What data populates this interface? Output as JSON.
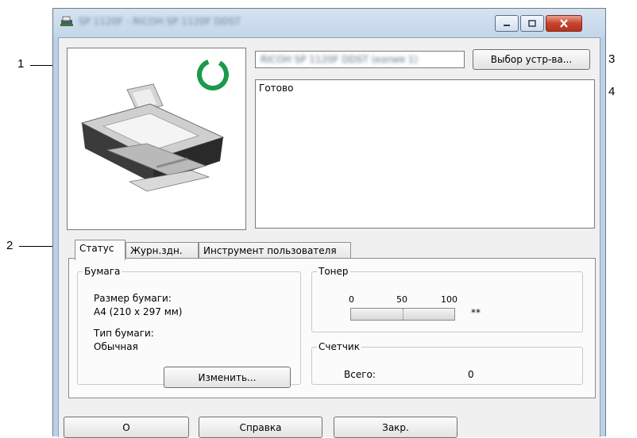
{
  "window": {
    "title": "SP 1120F - RICOH SP 1120F DDST"
  },
  "device": {
    "name_field_value": "RICOH SP 1120F DDST (копия 1)",
    "select_button_label": "Выбор устр-ва..."
  },
  "status": {
    "text": "Готово",
    "indicator_color": "#1a9a4a"
  },
  "tabs": [
    {
      "label": "Статус",
      "active": true
    },
    {
      "label": "Журн.здн.",
      "active": false
    },
    {
      "label": "Инструмент пользователя",
      "active": false
    }
  ],
  "paper": {
    "group_label": "Бумага",
    "size_label": "Размер бумаги:",
    "size_value": "A4 (210 x 297 мм)",
    "type_label": "Тип бумаги:",
    "type_value": "Обычная",
    "change_button_label": "Изменить..."
  },
  "toner": {
    "group_label": "Тонер",
    "scale_min": "0",
    "scale_mid": "50",
    "scale_max": "100",
    "level_text": "**"
  },
  "counter": {
    "group_label": "Счетчик",
    "total_label": "Всего:",
    "total_value": "0"
  },
  "bottom_buttons": {
    "ok_label": "O",
    "help_label": "Справка",
    "close_label": "Закр."
  },
  "callouts": [
    "1",
    "2",
    "3",
    "4"
  ]
}
